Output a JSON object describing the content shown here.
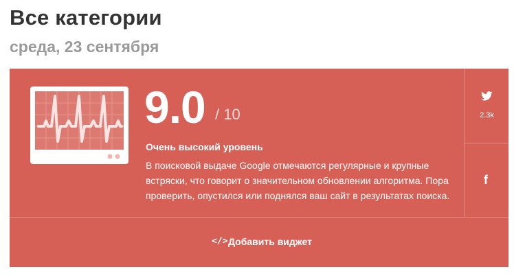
{
  "page": {
    "title": "Все категории",
    "date": "среда, 23 сентября"
  },
  "score": {
    "value": "9.0",
    "max": "/ 10",
    "level": "Очень высокий уровень",
    "description": "В поисковой выдаче Google отмечаются регулярные и крупные встряски, что говорит о значительном обновлении алгоритма. Пора проверить, опустился или поднялся ваш сайт в результатах поиска."
  },
  "share": {
    "twitter_icon": "twitter-bird-icon",
    "twitter_count": "2.3k",
    "facebook_icon": "facebook-icon",
    "facebook_glyph": "f"
  },
  "widget": {
    "icon": "code-icon",
    "icon_glyph": "</>",
    "label": "Добавить виджет"
  },
  "colors": {
    "card_background": "#d65f56",
    "title": "#333333",
    "subtitle": "#9a9a9a"
  }
}
